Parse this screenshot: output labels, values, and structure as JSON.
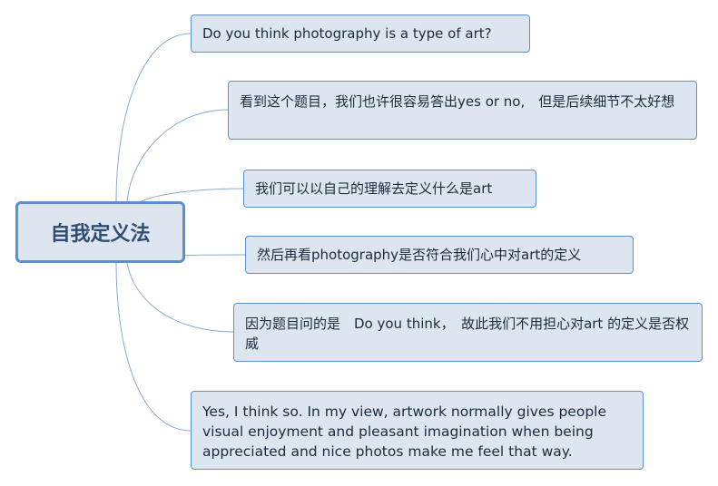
{
  "central_topic": "自我定义法",
  "topics": [
    "Do you think photography is a type of art?",
    "看到这个题目，我们也许很容易答出yes or no,　但是后续细节不太好想",
    "我们可以以自己的理解去定义什么是art",
    "然后再看photography是否符合我们心中对art的定义",
    "因为题目问的是　Do you think，　故此我们不用担心对art 的定义是否权威",
    "Yes, I think so. In my view, artwork normally gives people visual enjoyment and pleasant imagination when being appreciated and nice photos make me feel that way."
  ],
  "colors": {
    "node_fill": "#dde6f0",
    "node_border": "#5b8fd0",
    "connector": "#8aaad0",
    "central_text": "#2f4e72"
  }
}
